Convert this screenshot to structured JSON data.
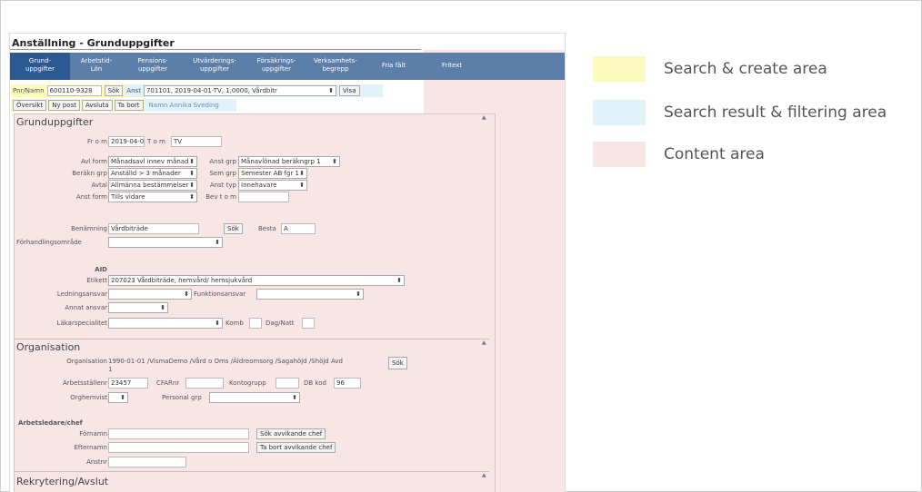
{
  "app": {
    "title": "Anställning - Grunduppgifter"
  },
  "tabs": [
    {
      "label": "Grund-\nuppgifter"
    },
    {
      "label": "Arbetstid-\nLön"
    },
    {
      "label": "Pensions-\nuppgifter"
    },
    {
      "label": "Utvärderings-\nuppgifter"
    },
    {
      "label": "Försäkrings-\nuppgifter"
    },
    {
      "label": "Verksamhets-\nbegrepp"
    },
    {
      "label": "Fria fält"
    },
    {
      "label": "Fritext"
    }
  ],
  "search": {
    "pnr_label": "Pnr/Namn",
    "pnr_value": "600110-9328",
    "sok_label": "Sök",
    "anst_label": "Anst",
    "anst_value": "701101, 2019-04-01-TV, 1,0000, Vårdbitr",
    "visa_label": "Visa"
  },
  "actions": {
    "oversikt": "Översikt",
    "ny_post": "Ny post",
    "avsluta": "Avsluta",
    "ta_bort": "Ta bort",
    "name_info": "Namn Annika Sveding"
  },
  "grund": {
    "title": "Grunduppgifter",
    "from_label": "Fr o m",
    "from_value": "2019-04-01",
    "tom_label": "T o m",
    "tom_value": "TV",
    "avlform_label": "Avl form",
    "avlform_value": "Månadsavl innev månad",
    "anstgrp_label": "Anst grp",
    "anstgrp_value": "Månavlönad beräkngrp 1",
    "beraknrp_label": "Beräkn grp",
    "beraknrp_value": "Anställd > 3 månader",
    "semgrp_label": "Sem grp",
    "semgrp_value": "Semester AB fgr 1",
    "avtal_label": "Avtal",
    "avtal_value": "Allmänna bestämmelser",
    "ansttyp_label": "Anst typ",
    "ansttyp_value": "Innehavare",
    "anstform_label": "Anst form",
    "anstform_value": "Tills vidare",
    "bevtom_label": "Bev t o m",
    "benamning_label": "Benämning",
    "benamning_value": "Vårdbiträde",
    "sok_label": "Sök",
    "besta_label": "Besta",
    "besta_value": "A",
    "forhandl_label": "Förhandlingsområde",
    "aid_label": "AID",
    "etikett_label": "Etikett",
    "etikett_value": "207023 Vårdbiträde, hemvård/ hemsjukvård",
    "ledning_label": "Ledningsansvar",
    "funktion_label": "Funktionsansvar",
    "annat_label": "Annat ansvar",
    "lakare_label": "Läkarspecialitet",
    "komb_label": "Komb",
    "dagnatt_label": "Dag/Natt"
  },
  "org": {
    "title": "Organisation",
    "org_label": "Organisation",
    "org_value": "1990-01-01 /VismaDemo /Vård o Oms /Äldreomsorg /Sagahöjd /Shöjd Avd",
    "org_value2": "1",
    "sok_label": "Sök",
    "arbst_label": "Arbetsställenr",
    "arbst_value": "23457",
    "cfar_label": "CFARnr",
    "konto_label": "Kontogrupp",
    "dbkod_label": "DB kod",
    "dbkod_value": "96",
    "orghemvist_label": "Orghemvist",
    "persgrp_label": "Personal grp",
    "chef_label": "Arbetsledare/chef",
    "fornamn_label": "Förnamn",
    "efternamn_label": "Efternamn",
    "anstnr_label": "Anstnr",
    "sok_chef": "Sök avvikande chef",
    "tabort_chef": "Ta bort avvikande chef"
  },
  "rekr": {
    "title": "Rekrytering/Avslut"
  },
  "legend": [
    {
      "label": "Search & create area",
      "color": "#fbfbbf"
    },
    {
      "label": "Search result & filtering area",
      "color": "#e2f2fb"
    },
    {
      "label": "Content area",
      "color": "#f7e6e5"
    }
  ]
}
